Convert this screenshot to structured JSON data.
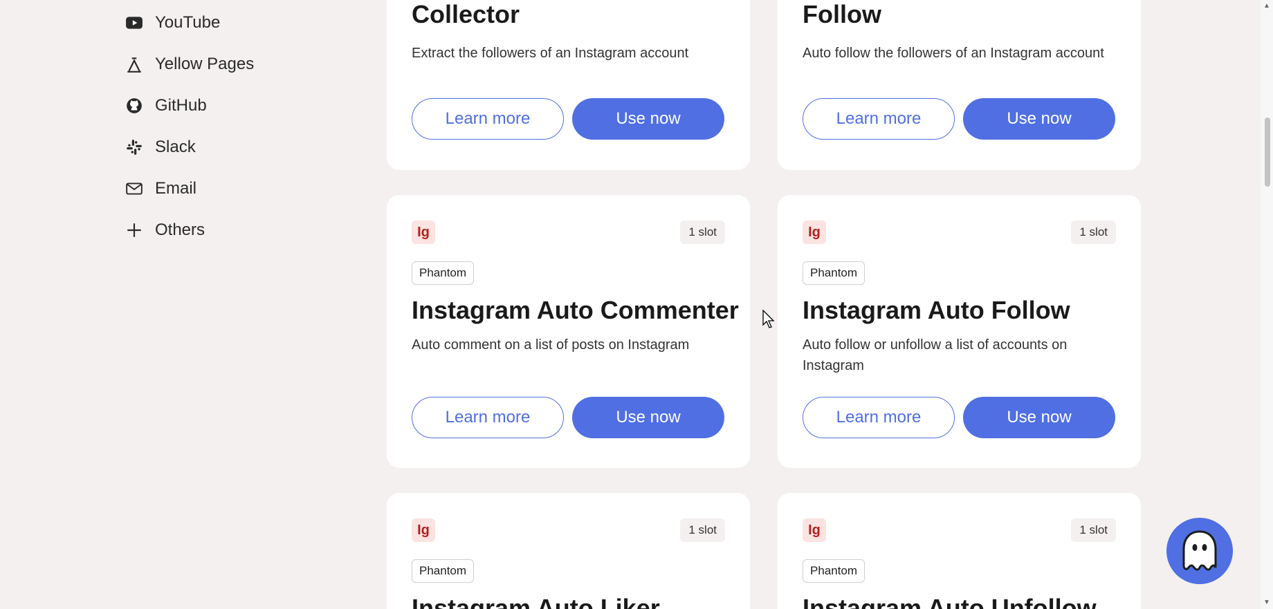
{
  "sidebar": {
    "items": [
      {
        "label": "YouTube",
        "icon": "youtube-icon"
      },
      {
        "label": "Yellow Pages",
        "icon": "yellow-pages-icon"
      },
      {
        "label": "GitHub",
        "icon": "github-icon"
      },
      {
        "label": "Slack",
        "icon": "slack-icon"
      },
      {
        "label": "Email",
        "icon": "email-icon"
      },
      {
        "label": "Others",
        "icon": "plus-icon"
      }
    ]
  },
  "buttons": {
    "learn_more": "Learn more",
    "use_now": "Use now"
  },
  "cards": [
    {
      "title": "Collector",
      "description": "Extract the followers of an Instagram account"
    },
    {
      "title": "Follow",
      "description": "Auto follow the followers of an Instagram account"
    },
    {
      "badge": "Ig",
      "slots": "1 slot",
      "tag": "Phantom",
      "title": "Instagram Auto Commenter",
      "description": "Auto comment on a list of posts on Instagram"
    },
    {
      "badge": "Ig",
      "slots": "1 slot",
      "tag": "Phantom",
      "title": "Instagram Auto Follow",
      "description": "Auto follow or unfollow a list of accounts on Instagram"
    },
    {
      "badge": "Ig",
      "slots": "1 slot",
      "tag": "Phantom",
      "title": "Instagram Auto Liker",
      "description": ""
    },
    {
      "badge": "Ig",
      "slots": "1 slot",
      "tag": "Phantom",
      "title": "Instagram Auto Unfollow",
      "description": ""
    }
  ],
  "colors": {
    "background": "#f4f0ef",
    "accent": "#4f6fe3",
    "ig_badge_bg": "#fbe3e1",
    "ig_badge_text": "#b41f1c"
  },
  "support_button": {
    "icon": "ghost-icon"
  }
}
